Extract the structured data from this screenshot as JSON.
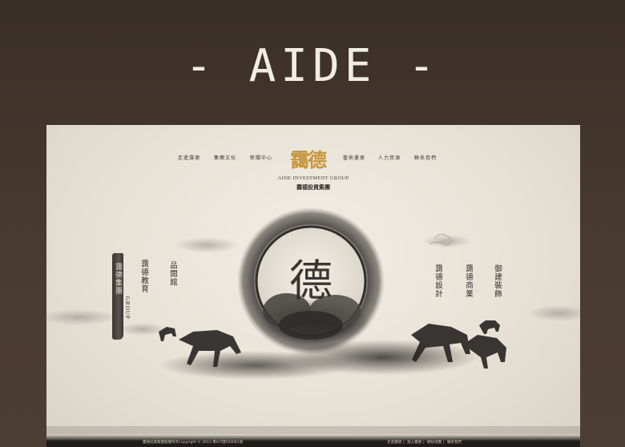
{
  "page_title": "- AIDE -",
  "nav": {
    "left": [
      "走進靄德",
      "集團文化",
      "新聞中心"
    ],
    "right": [
      "藝術畫册",
      "人力資源",
      "聯系我們"
    ]
  },
  "logo": {
    "cn": "靄德",
    "en": "AIDE INVESTMENT GROUP",
    "sub": "靄德投資集團"
  },
  "center_glyph": "德",
  "side": {
    "brush_label": "靄德集團",
    "group_en": "GROUP",
    "education": "靄德教育",
    "gallery": "品閱館",
    "design": "靄德設計",
    "business": "靄德商業",
    "decoration": "御建裝飾"
  },
  "footer": {
    "copyright": "靄德投資集團版權所有Copyright © 2013 粵ICP證050081號",
    "links": [
      "走進靄德",
      "加入靄德",
      "網站地圖",
      "聯系我們"
    ]
  },
  "colors": {
    "background": "#47392f",
    "paper": "#ebe7dc",
    "logo_gold": "#c6953a",
    "ink": "#2f2b27"
  }
}
